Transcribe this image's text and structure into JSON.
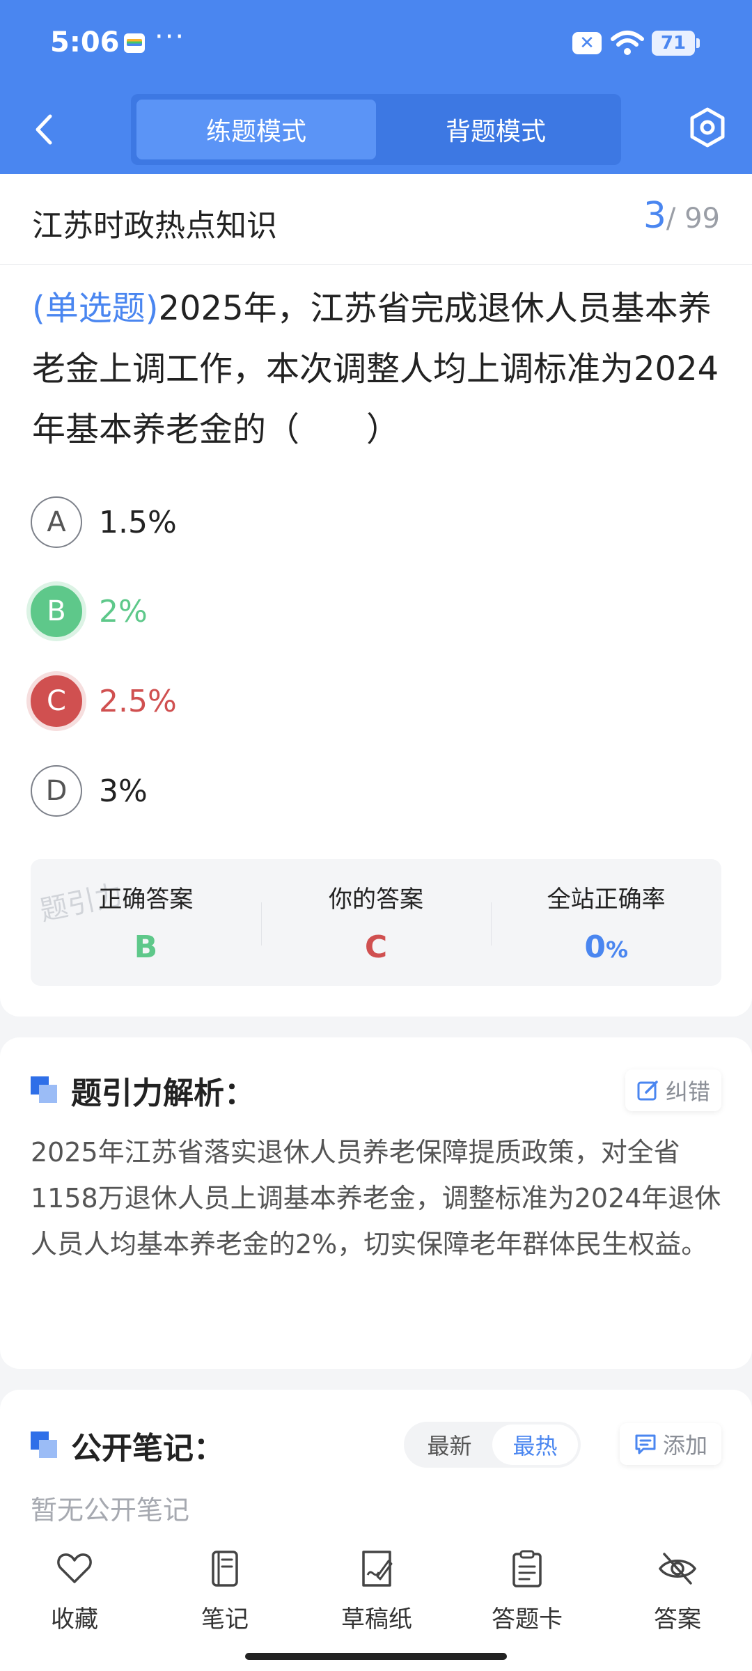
{
  "status_bar": {
    "time": "5:06",
    "dots": "···",
    "battery": "71",
    "notif_x": "✕"
  },
  "nav": {
    "tabs": [
      "练题模式",
      "背题模式"
    ],
    "active_tab": 0
  },
  "subject": {
    "title": "江苏时政热点知识",
    "current": "3",
    "total": "/ 99"
  },
  "question": {
    "type": "(单选题)",
    "text": "2025年，江苏省完成退休人员基本养老金上调工作，本次调整人均上调标准为2024年基本养老金的（　　）"
  },
  "options": [
    {
      "letter": "A",
      "text": "1.5%",
      "state": "normal"
    },
    {
      "letter": "B",
      "text": "2%",
      "state": "correct"
    },
    {
      "letter": "C",
      "text": "2.5%",
      "state": "wrong"
    },
    {
      "letter": "D",
      "text": "3%",
      "state": "normal"
    }
  ],
  "answer_summary": {
    "correct_label": "正确答案",
    "correct_value": "B",
    "yours_label": "你的答案",
    "yours_value": "C",
    "rate_label": "全站正确率",
    "rate_value": "0",
    "rate_unit": "%",
    "watermark": "题引力"
  },
  "analysis": {
    "title": "题引力解析：",
    "report_label": "纠错",
    "text": "2025年江苏省落实退休人员养老保障提质政策，对全省1158万退休人员上调基本养老金，调整标准为2024年退休人员人均基本养老金的2%，切实保障老年群体民生权益。"
  },
  "notes": {
    "title": "公开笔记：",
    "sort_tabs": [
      "最新",
      "最热"
    ],
    "active_sort": 1,
    "add_label": "添加",
    "empty_text": "暂无公开笔记"
  },
  "bottom_bar": [
    {
      "label": "收藏",
      "icon": "heart-icon"
    },
    {
      "label": "笔记",
      "icon": "notebook-icon"
    },
    {
      "label": "草稿纸",
      "icon": "draft-icon"
    },
    {
      "label": "答题卡",
      "icon": "answer-card-icon"
    },
    {
      "label": "答案",
      "icon": "eye-off-icon"
    }
  ],
  "colors": {
    "primary": "#4a86f0",
    "correct": "#5ec88a",
    "wrong": "#d05050"
  }
}
